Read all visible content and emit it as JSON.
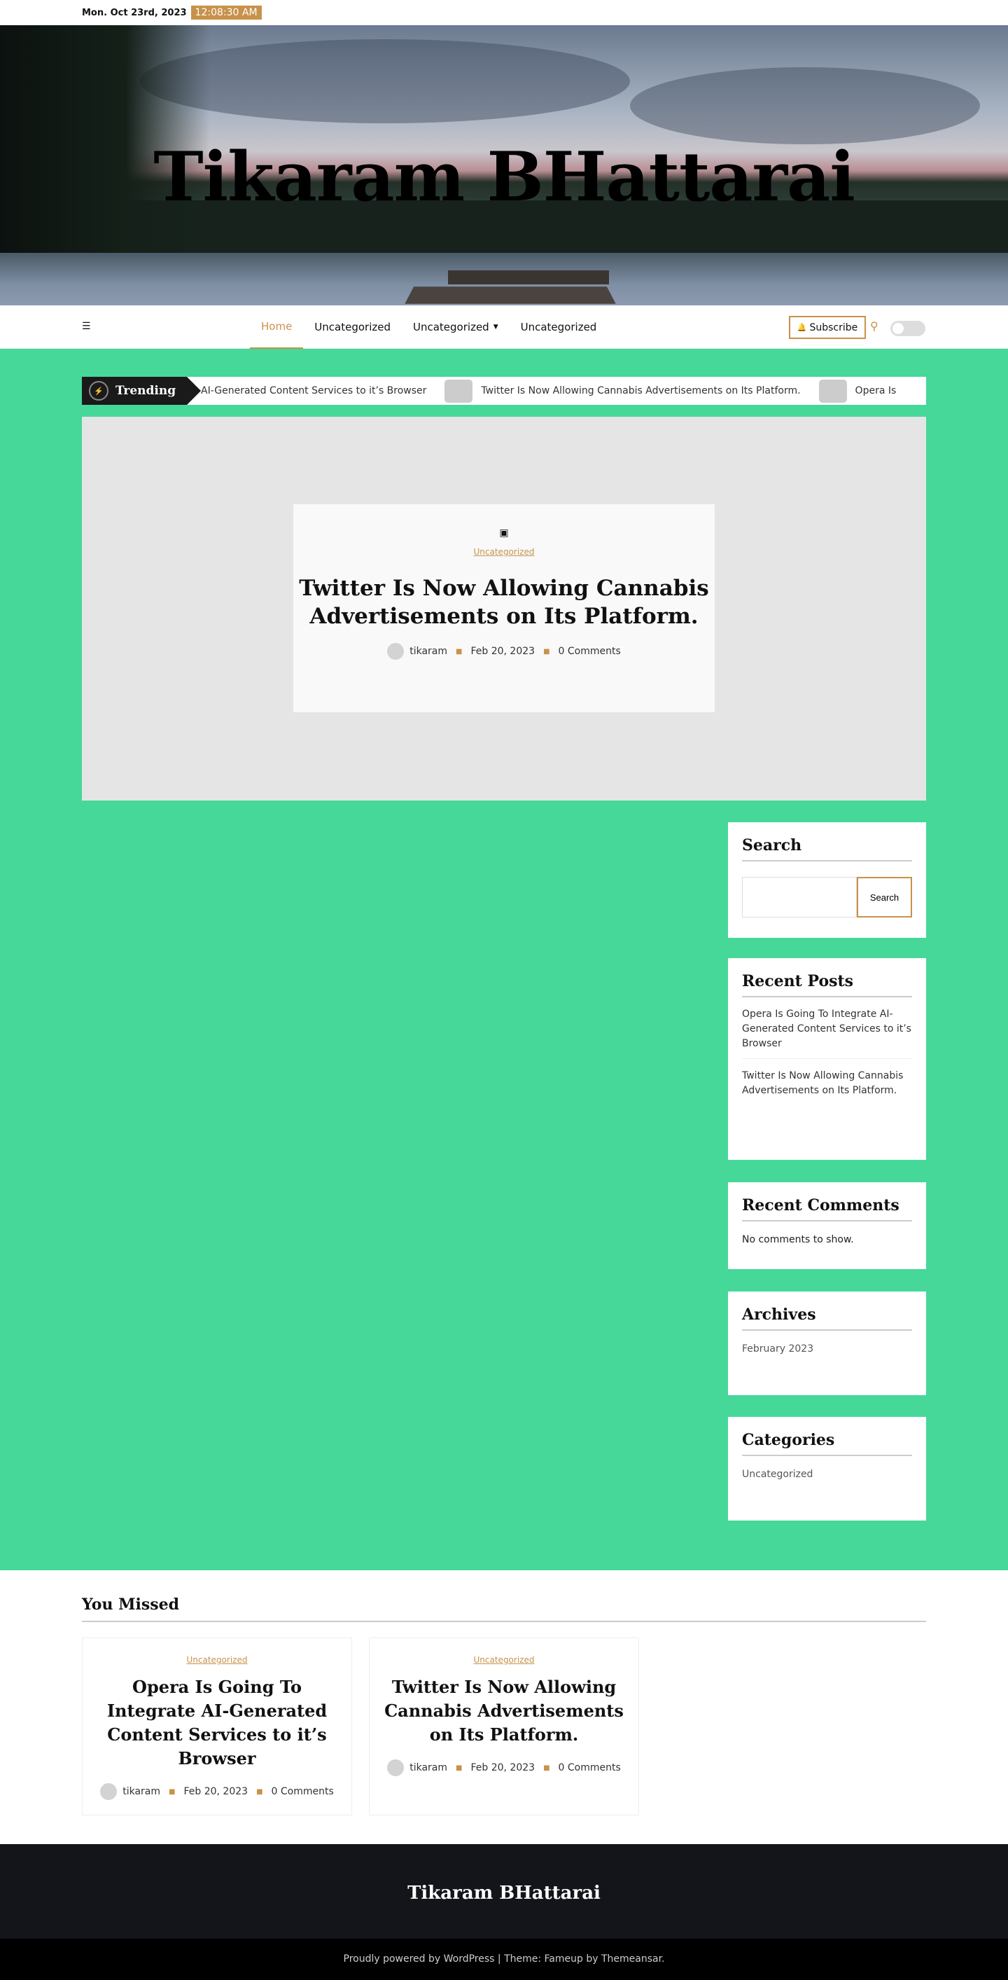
{
  "topbar": {
    "date": "Mon. Oct 23rd, 2023",
    "time": "12:08:30 AM"
  },
  "site": {
    "title": "Tikaram BHattarai"
  },
  "nav": {
    "items": [
      "Home",
      "Uncategorized",
      "Uncategorized",
      "Uncategorized"
    ],
    "subscribe": "Subscribe",
    "icons": {
      "menu": "menu-icon",
      "search": "search-icon",
      "bell": "bell-icon"
    }
  },
  "trending": {
    "label": "Trending",
    "items": [
      "AI-Generated Content Services to it’s Browser",
      "Twitter Is Now Allowing Cannabis Advertisements on Its Platform.",
      "Opera Is"
    ]
  },
  "featured": {
    "category": "Uncategorized",
    "title": "Twitter Is Now Allowing Cannabis Advertisements on Its Platform.",
    "author": "tikaram",
    "date": "Feb 20, 2023",
    "comments": "0 Comments"
  },
  "sidebar": {
    "search": {
      "title": "Search",
      "button": "Search"
    },
    "recent_posts": {
      "title": "Recent Posts",
      "items": [
        "Opera Is Going To Integrate AI-Generated Content Services to it’s Browser",
        "Twitter Is Now Allowing Cannabis Advertisements on Its Platform."
      ]
    },
    "recent_comments": {
      "title": "Recent Comments",
      "text": "No comments to show."
    },
    "archives": {
      "title": "Archives",
      "items": [
        "February 2023"
      ]
    },
    "categories": {
      "title": "Categories",
      "items": [
        "Uncategorized"
      ]
    }
  },
  "you_missed": {
    "title": "You Missed",
    "cards": [
      {
        "category": "Uncategorized",
        "title": "Opera Is Going To Integrate AI-Generated Content Services to it’s Browser",
        "author": "tikaram",
        "date": "Feb 20, 2023",
        "comments": "0 Comments"
      },
      {
        "category": "Uncategorized",
        "title": "Twitter Is Now Allowing Cannabis Advertisements on Its Platform.",
        "author": "tikaram",
        "date": "Feb 20, 2023",
        "comments": "0 Comments"
      }
    ]
  },
  "footer": {
    "title": "Tikaram BHattarai",
    "credit": "Proudly powered by WordPress | Theme: Fameup by Themeansar."
  },
  "colors": {
    "accent": "#c8924a",
    "main_bg": "#45d898",
    "footer_bg": "#14151a"
  }
}
